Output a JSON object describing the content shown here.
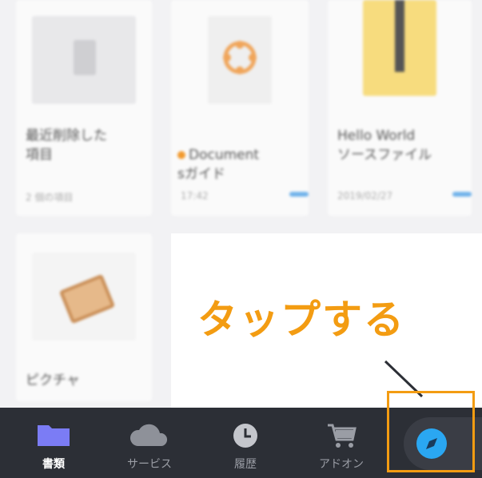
{
  "cards": [
    {
      "title": "最近削除した\n項目",
      "date": "2 個の項目"
    },
    {
      "title": "Document\nsガイド",
      "date": "17:42"
    },
    {
      "title": "Hello World\nソースファイル",
      "date": "2019/02/27"
    },
    {
      "title": "ピクチャ",
      "date": ""
    }
  ],
  "annotation": "タップする",
  "tabs": [
    {
      "label": "書類",
      "icon": "folder-icon"
    },
    {
      "label": "サービス",
      "icon": "cloud-icon"
    },
    {
      "label": "履歴",
      "icon": "clock-icon"
    },
    {
      "label": "アドオン",
      "icon": "cart-icon"
    }
  ],
  "browser_icon": "compass-icon",
  "colors": {
    "accent": "#f39c12",
    "tabbar_bg": "#2c2f36",
    "folder": "#7b7cf5",
    "compass": "#2aa7f2"
  }
}
